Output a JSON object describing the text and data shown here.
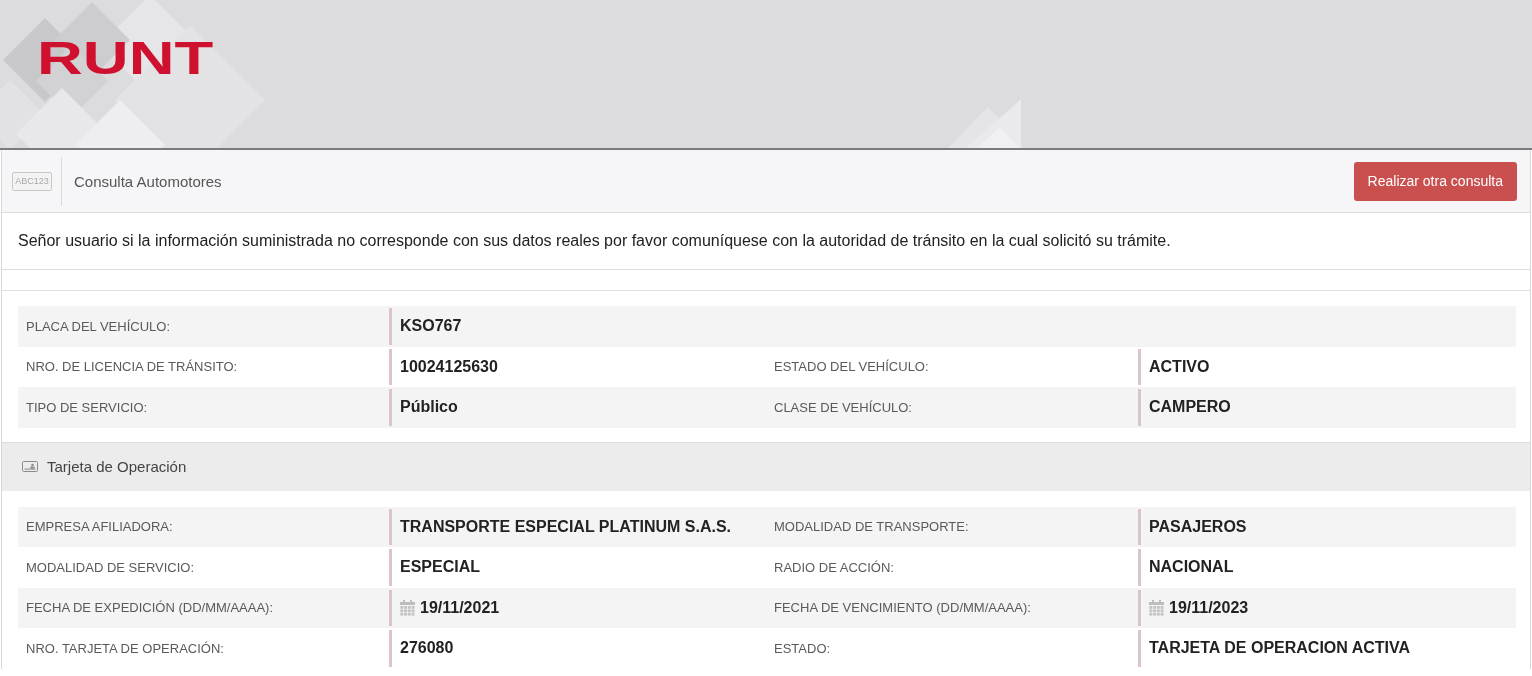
{
  "header": {
    "logo": "RUNT"
  },
  "toolbar": {
    "plate_text": "ABC123",
    "title": "Consulta Automotores",
    "button": "Realizar otra consulta"
  },
  "notice": "Señor usuario si la información suministrada no corresponde con sus datos reales por favor comuníquese con la autoridad de tránsito en la cual solicitó su trámite.",
  "vehicle": {
    "rows": [
      {
        "fields": [
          {
            "kind": "text",
            "label": "PLACA DEL VEHÍCULO:",
            "value": "KSO767"
          }
        ]
      },
      {
        "fields": [
          {
            "kind": "text",
            "label": "NRO. DE LICENCIA DE TRÁNSITO:",
            "value": "10024125630"
          },
          {
            "kind": "text",
            "label": "ESTADO DEL VEHÍCULO:",
            "value": "ACTIVO"
          }
        ]
      },
      {
        "fields": [
          {
            "kind": "text",
            "label": "TIPO DE SERVICIO:",
            "value": "Público"
          },
          {
            "kind": "text",
            "label": "CLASE DE VEHÍCULO:",
            "value": "CAMPERO"
          }
        ]
      }
    ]
  },
  "operation_card": {
    "title": "Tarjeta de Operación",
    "rows": [
      {
        "fields": [
          {
            "kind": "text",
            "label": "EMPRESA AFILIADORA:",
            "value": "TRANSPORTE ESPECIAL PLATINUM S.A.S."
          },
          {
            "kind": "text",
            "label": "MODALIDAD DE TRANSPORTE:",
            "value": "PASAJEROS"
          }
        ]
      },
      {
        "fields": [
          {
            "kind": "text",
            "label": "MODALIDAD DE SERVICIO:",
            "value": "ESPECIAL"
          },
          {
            "kind": "text",
            "label": "RADIO DE ACCIÓN:",
            "value": "NACIONAL"
          }
        ]
      },
      {
        "fields": [
          {
            "kind": "date",
            "label": "FECHA DE EXPEDICIÓN (DD/MM/AAAA):",
            "value": "19/11/2021"
          },
          {
            "kind": "date",
            "label": "FECHA DE VENCIMIENTO (DD/MM/AAAA):",
            "value": "19/11/2023"
          }
        ]
      },
      {
        "fields": [
          {
            "kind": "text",
            "label": "NRO. TARJETA DE OPERACIÓN:",
            "value": "276080"
          },
          {
            "kind": "text",
            "label": "ESTADO:",
            "value": "TARJETA DE OPERACION ACTIVA"
          }
        ]
      }
    ]
  }
}
